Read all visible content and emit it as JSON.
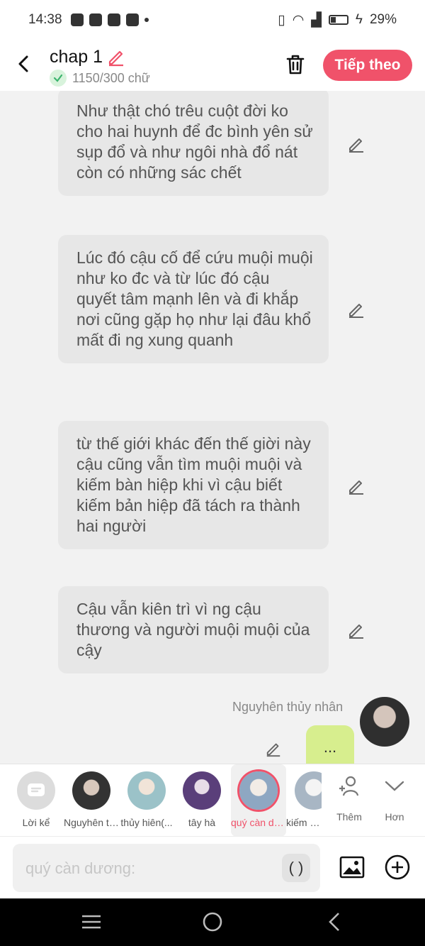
{
  "status_bar": {
    "time": "14:38",
    "battery": "29%"
  },
  "header": {
    "title": "chap 1",
    "word_count": "1150/300 chữ",
    "next_label": "Tiếp theo",
    "accent": "#f0526a"
  },
  "messages": [
    {
      "text": "Như thật chó trêu cuột đời ko cho hai huynh để đc bình yên sử sụp đổ và như ngôi nhà đổ nát còn có những sác chết"
    },
    {
      "text": "Lúc đó cậu cố để cứu muội muội như ko đc và từ lúc đó cậu quyết tâm mạnh lên và đi khắp nơi cũng gặp họ như lại đâu khổ mất đi ng xung quanh"
    },
    {
      "text": "từ thế giới khác đến thế giời này cậu cũng vẫn tìm muội muội và kiếm bàn hiệp khi vì cậu biết kiếm bản hiệp đã tách ra thành hai người"
    },
    {
      "text": "Cậu vẫn kiên trì vì ng cậu thương và người muội muội của cậy"
    }
  ],
  "speaker": {
    "name": "Nguyhên thủy nhân",
    "bubble_text": "..."
  },
  "characters": [
    {
      "label": "Lời kể"
    },
    {
      "label": "Nguyhên thủy nhân"
    },
    {
      "label": "thủy hiên(..."
    },
    {
      "label": "tây hà"
    },
    {
      "label": "quý càn dương",
      "selected": true
    },
    {
      "label": "kiếm bàn hiệp"
    }
  ],
  "more_buttons": [
    {
      "label": "Thêm",
      "icon": "add-person-icon"
    },
    {
      "label": "Hơn",
      "icon": "chevron-down-icon"
    }
  ],
  "input": {
    "placeholder": "quý càn dương:",
    "paren_label": "( )"
  }
}
